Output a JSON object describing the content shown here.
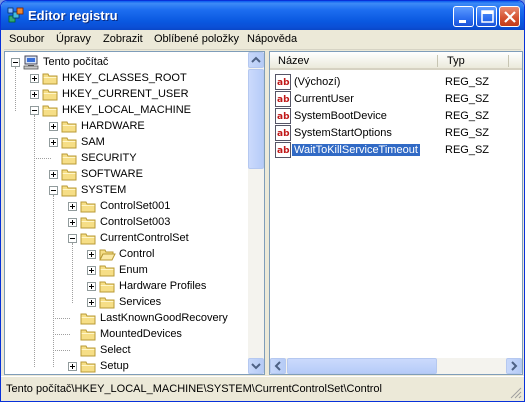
{
  "window": {
    "title": "Editor registru"
  },
  "menu": [
    "Soubor",
    "Úpravy",
    "Zobrazit",
    "Oblíbené položky",
    "Nápověda"
  ],
  "tree": [
    {
      "label": "Tento počítač",
      "icon": "computer-icon",
      "toggle": "minus"
    },
    {
      "label": "HKEY_CLASSES_ROOT",
      "icon": "folder-icon",
      "toggle": "plus"
    },
    {
      "label": "HKEY_CURRENT_USER",
      "icon": "folder-icon",
      "toggle": "plus"
    },
    {
      "label": "HKEY_LOCAL_MACHINE",
      "icon": "folder-icon",
      "toggle": "minus"
    },
    {
      "label": "HARDWARE",
      "icon": "folder-icon",
      "toggle": "plus"
    },
    {
      "label": "SAM",
      "icon": "folder-icon",
      "toggle": "plus"
    },
    {
      "label": "SECURITY",
      "icon": "folder-icon",
      "toggle": "none"
    },
    {
      "label": "SOFTWARE",
      "icon": "folder-icon",
      "toggle": "plus"
    },
    {
      "label": "SYSTEM",
      "icon": "folder-icon",
      "toggle": "minus"
    },
    {
      "label": "ControlSet001",
      "icon": "folder-icon",
      "toggle": "plus"
    },
    {
      "label": "ControlSet003",
      "icon": "folder-icon",
      "toggle": "plus"
    },
    {
      "label": "CurrentControlSet",
      "icon": "folder-icon",
      "toggle": "minus"
    },
    {
      "label": "Control",
      "icon": "open-folder-icon",
      "toggle": "plus"
    },
    {
      "label": "Enum",
      "icon": "folder-icon",
      "toggle": "plus"
    },
    {
      "label": "Hardware Profiles",
      "icon": "folder-icon",
      "toggle": "plus"
    },
    {
      "label": "Services",
      "icon": "folder-icon",
      "toggle": "plus"
    },
    {
      "label": "LastKnownGoodRecovery",
      "icon": "folder-icon",
      "toggle": "none"
    },
    {
      "label": "MountedDevices",
      "icon": "folder-icon",
      "toggle": "none"
    },
    {
      "label": "Select",
      "icon": "folder-icon",
      "toggle": "none"
    },
    {
      "label": "Setup",
      "icon": "folder-icon",
      "toggle": "plus"
    }
  ],
  "list": {
    "columns": {
      "name": "Název",
      "type": "Typ"
    },
    "rows": [
      {
        "name": "(Výchozí)",
        "type": "REG_SZ",
        "icon": "string-value-icon"
      },
      {
        "name": "CurrentUser",
        "type": "REG_SZ",
        "icon": "string-value-icon"
      },
      {
        "name": "SystemBootDevice",
        "type": "REG_SZ",
        "icon": "string-value-icon"
      },
      {
        "name": "SystemStartOptions",
        "type": "REG_SZ",
        "icon": "string-value-icon"
      },
      {
        "name": "WaitToKillServiceTimeout",
        "type": "REG_SZ",
        "icon": "string-value-icon",
        "selected": true
      }
    ]
  },
  "status": {
    "path": "Tento počítač\\HKEY_LOCAL_MACHINE\\SYSTEM\\CurrentControlSet\\Control"
  },
  "colors": {
    "titlebar": "#0a5cf0",
    "selection": "#316ac5",
    "window_bg": "#ece9d8"
  }
}
